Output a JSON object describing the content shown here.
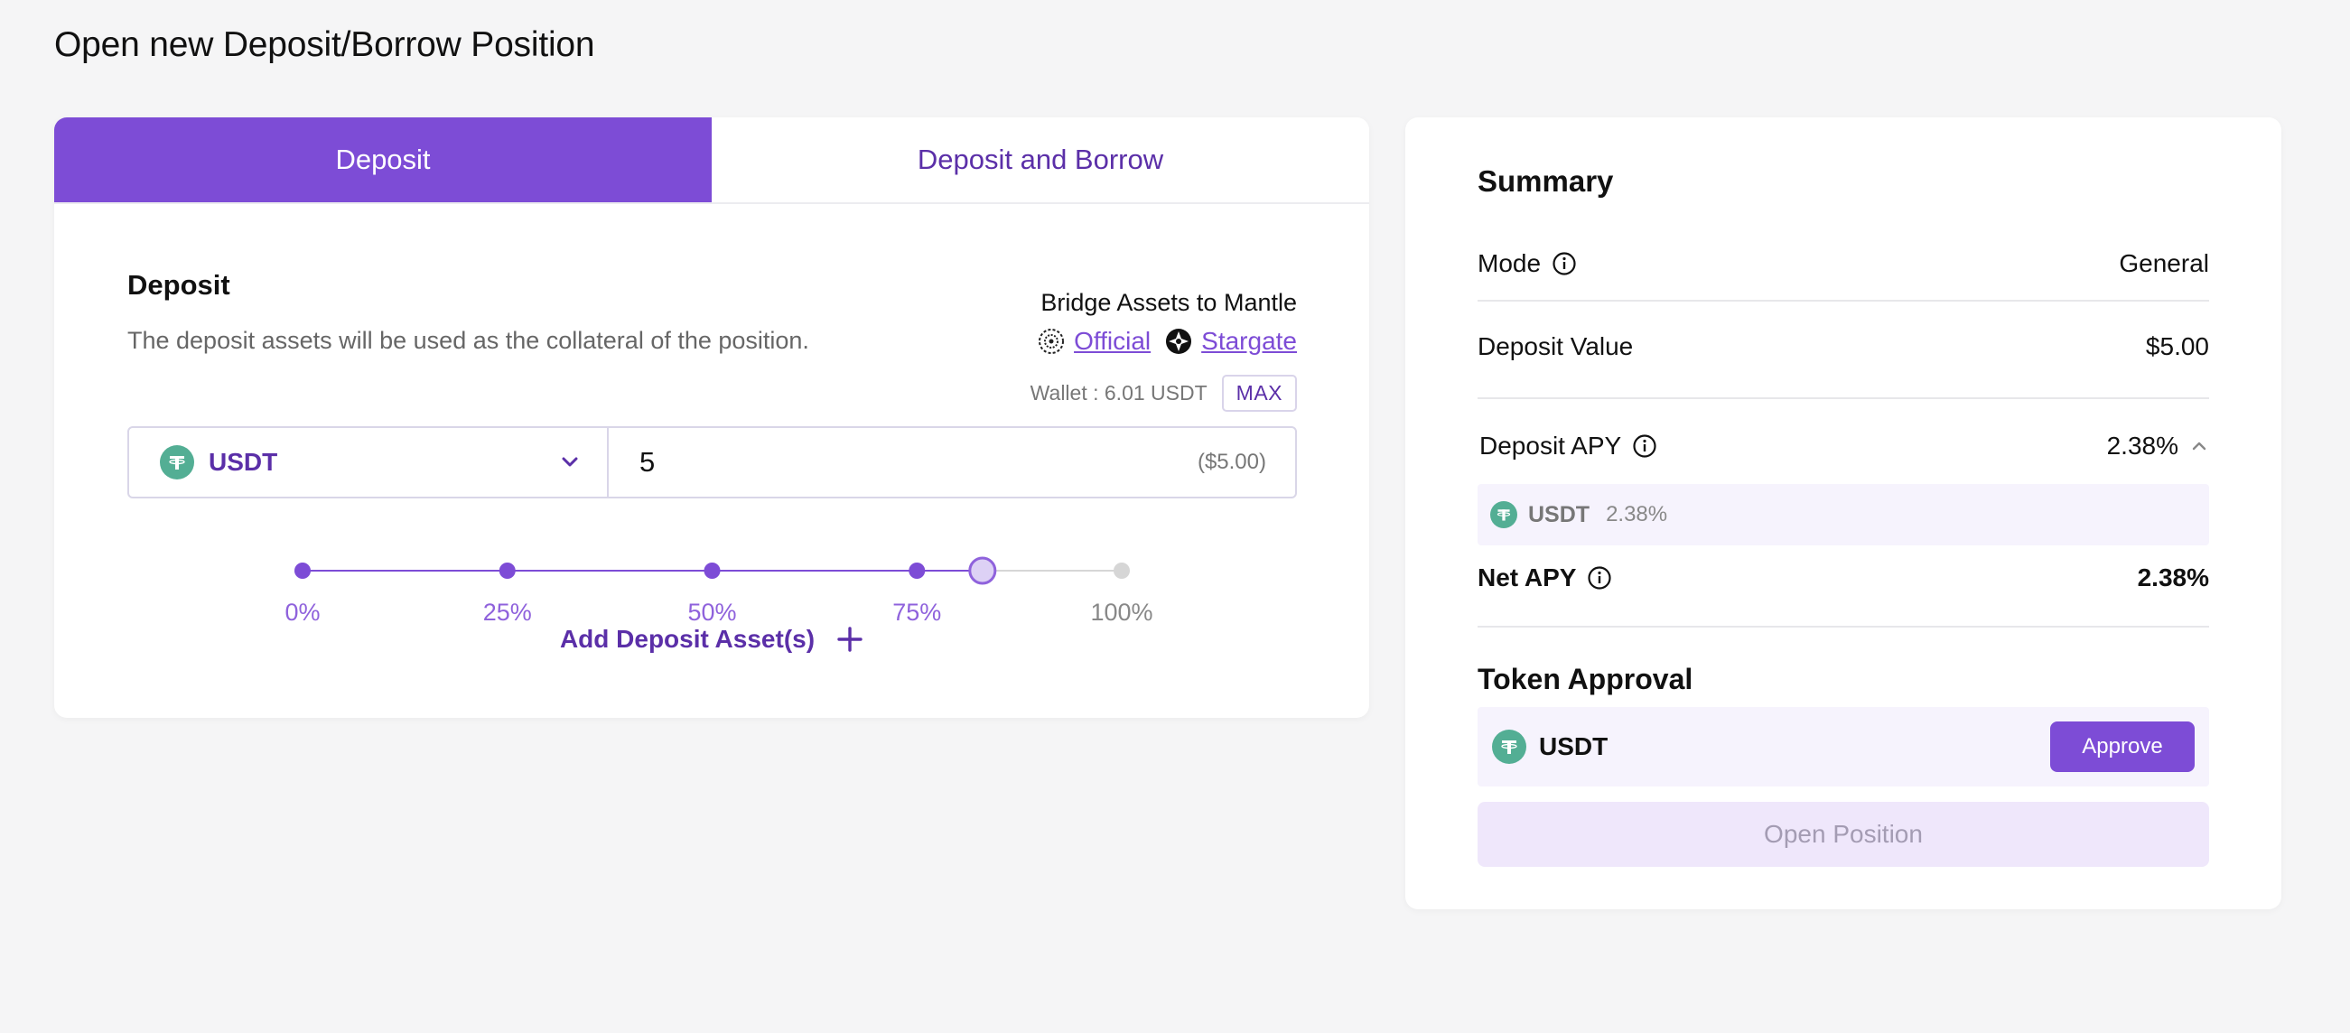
{
  "page": {
    "title": "Open new Deposit/Borrow Position"
  },
  "tabs": [
    {
      "label": "Deposit",
      "active": true
    },
    {
      "label": "Deposit and Borrow",
      "active": false
    }
  ],
  "deposit": {
    "heading": "Deposit",
    "description": "The deposit assets will be used as the collateral of the position.",
    "bridge": {
      "title": "Bridge Assets to Mantle",
      "official_label": "Official",
      "stargate_label": "Stargate"
    },
    "wallet_text": "Wallet : 6.01 USDT",
    "max_label": "MAX",
    "asset": {
      "symbol": "USDT",
      "icon": "tether-icon"
    },
    "amount": "5",
    "amount_usd": "($5.00)",
    "slider": {
      "marks": [
        "0%",
        "25%",
        "50%",
        "75%",
        "100%"
      ],
      "value_percent": 83
    },
    "add_asset_label": "Add Deposit Asset(s)"
  },
  "summary": {
    "title": "Summary",
    "mode_label": "Mode",
    "mode_value": "General",
    "deposit_value_label": "Deposit Value",
    "deposit_value": "$5.00",
    "deposit_apy_label": "Deposit APY",
    "deposit_apy_value": "2.38%",
    "apy_breakdown": [
      {
        "symbol": "USDT",
        "apy": "2.38%"
      }
    ],
    "net_apy_label": "Net APY",
    "net_apy_value": "2.38%",
    "token_approval_title": "Token Approval",
    "approval_token": "USDT",
    "approve_label": "Approve",
    "open_position_label": "Open Position"
  },
  "colors": {
    "accent": "#7d4cd6",
    "accent_dark": "#5b2fa8",
    "tether": "#53ae94",
    "slider_inactive": "#d6d6d6"
  }
}
